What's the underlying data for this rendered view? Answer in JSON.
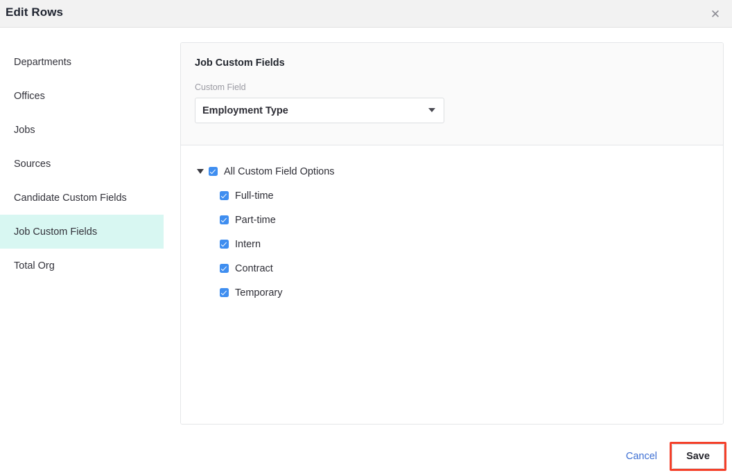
{
  "header": {
    "title": "Edit Rows",
    "close_icon": "close-icon",
    "close_glyph": "✕"
  },
  "sidebar": {
    "items": [
      {
        "label": "Departments",
        "active": false
      },
      {
        "label": "Offices",
        "active": false
      },
      {
        "label": "Jobs",
        "active": false
      },
      {
        "label": "Sources",
        "active": false
      },
      {
        "label": "Candidate Custom Fields",
        "active": false
      },
      {
        "label": "Job Custom Fields",
        "active": true
      },
      {
        "label": "Total Org",
        "active": false
      }
    ],
    "active_highlight_color": "#d8f7f2"
  },
  "panel": {
    "heading": "Job Custom Fields",
    "field_label": "Custom Field",
    "select": {
      "value": "Employment Type",
      "caret_icon": "chevron-down-icon"
    },
    "tree": {
      "disclosure_icon": "triangle-down-icon",
      "root": {
        "label": "All Custom Field Options",
        "checked": true
      },
      "options": [
        {
          "label": "Full-time",
          "checked": true
        },
        {
          "label": "Part-time",
          "checked": true
        },
        {
          "label": "Intern",
          "checked": true
        },
        {
          "label": "Contract",
          "checked": true
        },
        {
          "label": "Temporary",
          "checked": true
        }
      ],
      "checkbox_color": "#3f8ef0"
    }
  },
  "footer": {
    "cancel_label": "Cancel",
    "save_label": "Save",
    "cancel_color": "#3d6fd3",
    "save_highlight_color": "#f4402a"
  }
}
